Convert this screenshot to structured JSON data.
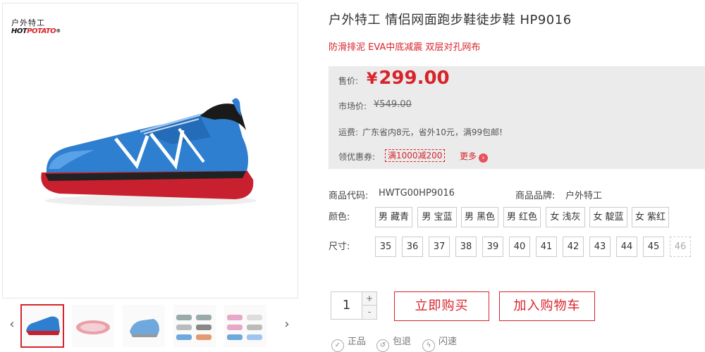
{
  "brand": {
    "logo_cn": "户外特工",
    "logo_en_prefix": "HOT",
    "logo_en_suffix": "POTATO",
    "logo_reg": "®"
  },
  "gallery": {
    "prev": "‹",
    "next": "›"
  },
  "product": {
    "title": "户外特工 情侣网面跑步鞋徒步鞋 HP9016",
    "subtitle": "防滑排泥 EVA中底减震 双层对孔网布"
  },
  "price": {
    "label": "售价:",
    "currency": "¥",
    "value": "299.00",
    "market_label": "市场价:",
    "market_value": "¥549.00",
    "shipping_label": "运费:",
    "shipping_text": "广东省内8元，省外10元，满99包邮!",
    "coupon_label": "领优惠券:",
    "coupon_text": "满1000减200",
    "more_label": "更多",
    "more_icon": "›"
  },
  "info": {
    "code_label": "商品代码:",
    "code_value": "HWTG00HP9016",
    "brand_label": "商品品牌:",
    "brand_value": "户外特工"
  },
  "color": {
    "label": "颜色:",
    "options": [
      "男 藏青",
      "男 宝蓝",
      "男 黑色",
      "男 红色",
      "女 浅灰",
      "女 靛蓝",
      "女 紫红"
    ]
  },
  "size": {
    "label": "尺寸:",
    "options": [
      "35",
      "36",
      "37",
      "38",
      "39",
      "40",
      "41",
      "42",
      "43",
      "44",
      "45",
      "46"
    ]
  },
  "purchase": {
    "quantity": "1",
    "plus": "+",
    "minus": "-",
    "buy_now": "立即购买",
    "add_cart": "加入购物车"
  },
  "assurance": {
    "genuine": "正品",
    "free_ship": "包退",
    "fast": "闪速"
  },
  "colors": {
    "accent": "#d8232a",
    "shoe_blue": "#2e7fd0",
    "sole_red": "#c8202e",
    "price_bg": "#ebebeb"
  }
}
